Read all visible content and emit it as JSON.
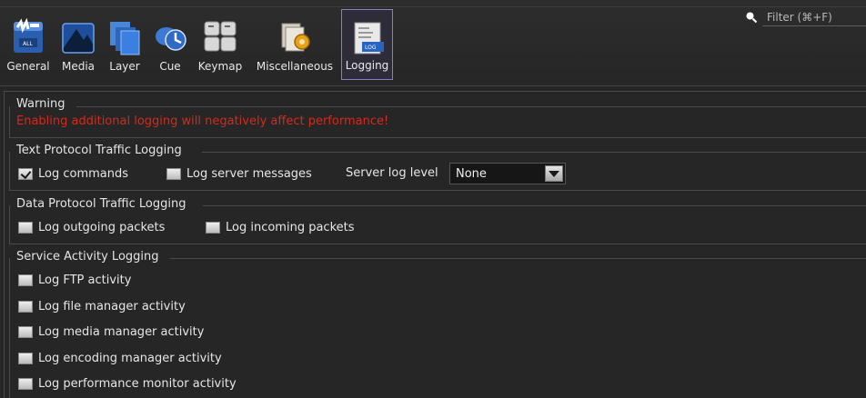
{
  "toolbar": {
    "tabs": [
      {
        "id": "general",
        "label": "General",
        "icon": "general-icon"
      },
      {
        "id": "media",
        "label": "Media",
        "icon": "media-icon"
      },
      {
        "id": "layer",
        "label": "Layer",
        "icon": "layer-icon"
      },
      {
        "id": "cue",
        "label": "Cue",
        "icon": "cue-icon"
      },
      {
        "id": "keymap",
        "label": "Keymap",
        "icon": "keymap-icon"
      },
      {
        "id": "misc",
        "label": "Miscellaneous",
        "icon": "miscellaneous-icon"
      },
      {
        "id": "logging",
        "label": "Logging",
        "icon": "logging-icon",
        "active": true
      }
    ]
  },
  "search": {
    "placeholder": "Filter (⌘+F)",
    "icon": "search-icon"
  },
  "warning": {
    "title": "Warning",
    "message": "Enabling additional logging will negatively affect performance!",
    "color": "#d42a1c"
  },
  "text_protocol": {
    "title": "Text Protocol Traffic Logging",
    "log_commands": {
      "label": "Log commands",
      "checked": true
    },
    "log_server_messages": {
      "label": "Log server messages",
      "checked": false
    },
    "server_log_level": {
      "label": "Server log level",
      "value": "None"
    }
  },
  "data_protocol": {
    "title": "Data Protocol Traffic Logging",
    "log_outgoing": {
      "label": "Log outgoing packets",
      "checked": false
    },
    "log_incoming": {
      "label": "Log incoming packets",
      "checked": false
    }
  },
  "service_activity": {
    "title": "Service Activity Logging",
    "items": [
      {
        "label": "Log FTP activity",
        "checked": false
      },
      {
        "label": "Log file manager activity",
        "checked": false
      },
      {
        "label": "Log media manager activity",
        "checked": false
      },
      {
        "label": "Log encoding manager activity",
        "checked": false
      },
      {
        "label": "Log performance monitor activity",
        "checked": false
      }
    ]
  },
  "colors": {
    "background": "#262626",
    "accent": "#8b7cc7",
    "text": "#e0e0e0"
  }
}
